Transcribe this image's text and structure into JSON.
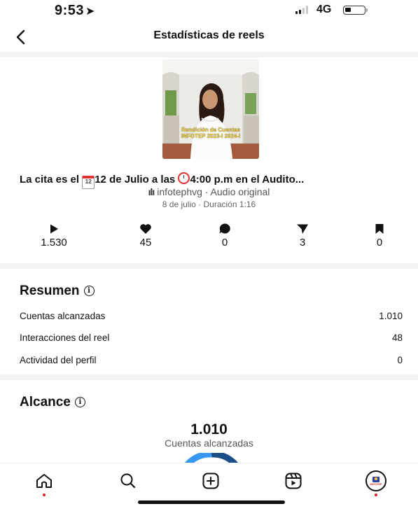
{
  "status_bar": {
    "time": "9:53",
    "network": "4G"
  },
  "header": {
    "title": "Estadísticas de reels"
  },
  "reel": {
    "thumbnail_text_line1": "Rendición de Cuentas",
    "thumbnail_text_line2": "INFOTEP 2023-I 2024-I",
    "caption_part1": "La cita es el ",
    "caption_cal_day": "12",
    "caption_part2": "12 de Julio a las ",
    "caption_part3": "4:00 p.m en el Audito...",
    "audio": "infotephvg · Audio original",
    "meta": "8 de julio · Duración 1:16"
  },
  "metrics": [
    {
      "icon": "play-icon",
      "value": "1.530"
    },
    {
      "icon": "heart-icon",
      "value": "45"
    },
    {
      "icon": "comment-icon",
      "value": "0"
    },
    {
      "icon": "share-icon",
      "value": "3"
    },
    {
      "icon": "bookmark-icon",
      "value": "0"
    }
  ],
  "resumen": {
    "title": "Resumen",
    "rows": [
      {
        "label": "Cuentas alcanzadas",
        "value": "1.010"
      },
      {
        "label": "Interacciones del reel",
        "value": "48"
      },
      {
        "label": "Actividad del perfil",
        "value": "0"
      }
    ]
  },
  "alcance": {
    "title": "Alcance",
    "number": "1.010",
    "label": "Cuentas alcanzadas"
  },
  "tab_bar": {
    "items": [
      "home-icon",
      "search-icon",
      "create-icon",
      "reels-icon",
      "profile-avatar"
    ],
    "profile_avatar_text": "INFOTEP"
  },
  "colors": {
    "accent_blue": "#3897f0",
    "dark_blue": "#1b4f8a",
    "notification_red": "#e02020"
  }
}
